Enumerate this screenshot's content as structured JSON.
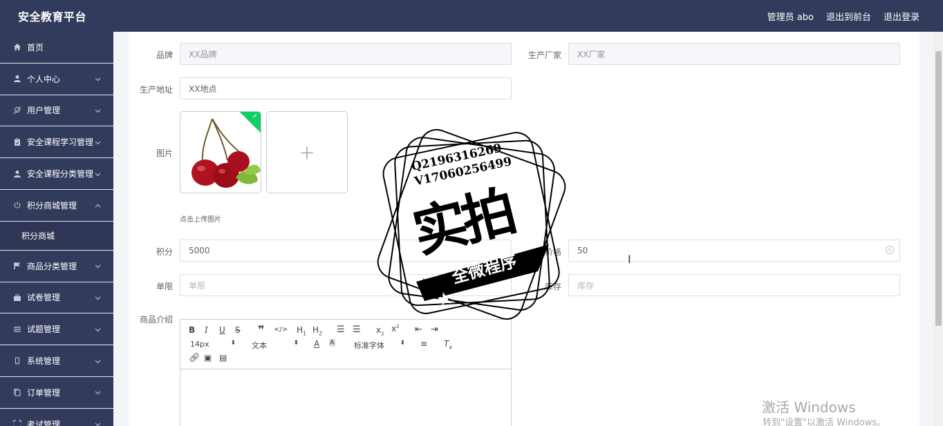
{
  "header": {
    "title": "安全教育平台",
    "links": [
      "管理员 abo",
      "退出到前台",
      "退出登录"
    ]
  },
  "sidebar": {
    "items": [
      {
        "label": "首页",
        "icon": "home-icon"
      },
      {
        "label": "个人中心",
        "icon": "user-icon"
      },
      {
        "label": "用户管理",
        "icon": "user-manage-icon"
      },
      {
        "label": "安全课程学习管理",
        "icon": "clipboard-icon"
      },
      {
        "label": "安全课程分类管理",
        "icon": "user-icon"
      },
      {
        "label": "积分商城管理",
        "icon": "power-icon",
        "expanded": true,
        "sub": "积分商城"
      },
      {
        "label": "商品分类管理",
        "icon": "flag-icon"
      },
      {
        "label": "试卷管理",
        "icon": "briefcase-icon"
      },
      {
        "label": "试题管理",
        "icon": "list-icon"
      },
      {
        "label": "系统管理",
        "icon": "phone-icon"
      },
      {
        "label": "订单管理",
        "icon": "copy-icon"
      },
      {
        "label": "考试管理",
        "icon": "frame-icon"
      }
    ]
  },
  "form": {
    "brand": {
      "label": "品牌",
      "value": "XX品牌"
    },
    "manufacturer": {
      "label": "生产厂家",
      "value": "XX厂家"
    },
    "address": {
      "label": "生产地址",
      "value": "XX地点"
    },
    "image": {
      "label": "图片",
      "tip": "点击上传图片"
    },
    "points": {
      "label": "积分",
      "value": "5000"
    },
    "price": {
      "label": "价格",
      "value": "50"
    },
    "limit": {
      "label": "单限",
      "placeholder": "单限"
    },
    "stock": {
      "label": "库存",
      "placeholder": "库存"
    },
    "intro": {
      "label": "商品介绍"
    }
  },
  "editor": {
    "font_size": "14px",
    "block_type": "文本",
    "font_family": "标准字体"
  },
  "watermark": {
    "qq": "Q2196316269",
    "vx": "V17060256499",
    "main": "实拍",
    "banner": "全微程序"
  },
  "windows": {
    "line1": "激活 Windows",
    "line2": "转到\"设置\"以激活 Windows。"
  },
  "colors": {
    "sidebar_bg": "#333b5c",
    "success": "#13ce66"
  }
}
